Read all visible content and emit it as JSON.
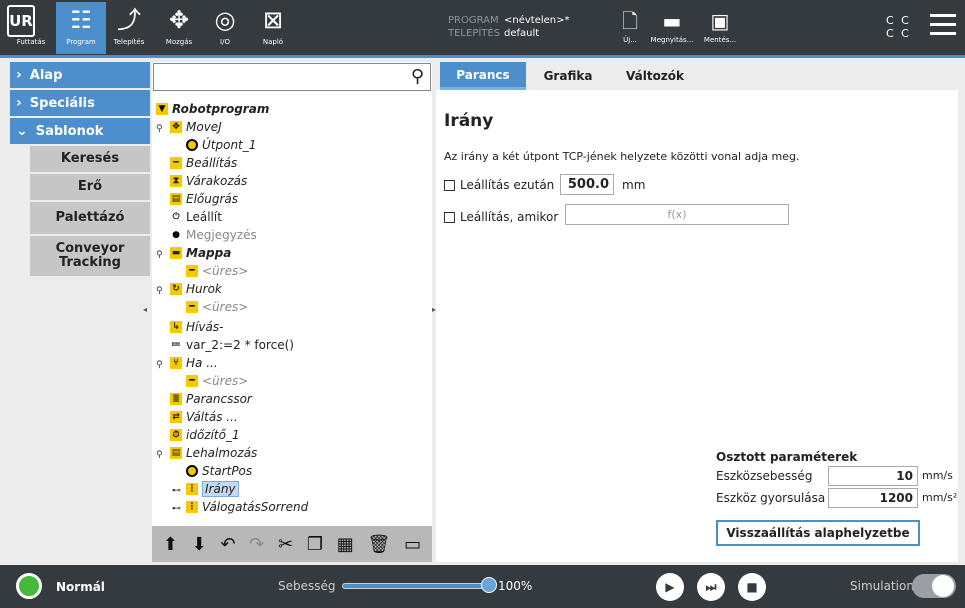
{
  "top_nav": [
    {
      "label": "Futtatás",
      "icon": "run-icon",
      "active": false
    },
    {
      "label": "Program",
      "icon": "program-icon",
      "active": true
    },
    {
      "label": "Telepítés",
      "icon": "installation-icon",
      "active": false
    },
    {
      "label": "Mozgás",
      "icon": "move-icon",
      "active": false
    },
    {
      "label": "I/O",
      "icon": "io-icon",
      "active": false
    },
    {
      "label": "Napló",
      "icon": "log-icon",
      "active": false
    }
  ],
  "program_info": {
    "program_key": "PROGRAM",
    "program_value": "<névtelen>*",
    "install_key": "TELEPÍTÉS",
    "install_value": "default"
  },
  "file_buttons": [
    {
      "label": "Új...",
      "icon": "new-file-icon"
    },
    {
      "label": "Megnyitás...",
      "icon": "folder-icon"
    },
    {
      "label": "Mentés...",
      "icon": "save-icon"
    }
  ],
  "cc_text": {
    "line1": "C C",
    "line2": "C C"
  },
  "sidebar": {
    "categories": [
      {
        "label": "Alap",
        "expanded": false
      },
      {
        "label": "Speciális",
        "expanded": false
      },
      {
        "label": "Sablonok",
        "expanded": true
      }
    ],
    "items": [
      "Keresés",
      "Erő",
      "Palettázó",
      "Conveyor Tracking"
    ]
  },
  "tree": {
    "nodes": [
      {
        "label": "Robotprogram",
        "icon": "flag-icon"
      },
      {
        "label": "MoveJ",
        "icon": "movej-icon"
      },
      {
        "label": "Útpont_1",
        "icon": "waypoint-icon"
      },
      {
        "label": "Beállítás",
        "icon": "set-icon"
      },
      {
        "label": "Várakozás",
        "icon": "wait-icon"
      },
      {
        "label": "Előugrás",
        "icon": "popup-icon"
      },
      {
        "label": "Leállít",
        "icon": "halt-icon"
      },
      {
        "label": "Megjegyzés",
        "icon": "comment-icon"
      },
      {
        "label": "Mappa",
        "icon": "folder-icon"
      },
      {
        "label": "<üres>",
        "icon": "empty-icon"
      },
      {
        "label": "Hurok",
        "icon": "loop-icon"
      },
      {
        "label": "<üres>",
        "icon": "empty-icon"
      },
      {
        "label": "Hívás-",
        "icon": "call-icon"
      },
      {
        "label": "var_2:=2 * force()",
        "icon": "assignment-icon"
      },
      {
        "label": "Ha ...",
        "icon": "if-icon"
      },
      {
        "label": "<üres>",
        "icon": "empty-icon"
      },
      {
        "label": "Parancssor",
        "icon": "script-icon"
      },
      {
        "label": "Váltás ...",
        "icon": "switch-icon"
      },
      {
        "label": "időzítő_1",
        "icon": "timer-icon"
      },
      {
        "label": "Lehalmozás",
        "icon": "stack-icon"
      },
      {
        "label": "StartPos",
        "icon": "waypoint-icon"
      },
      {
        "label": "Irány",
        "icon": "direction-icon"
      },
      {
        "label": "VálogatásSorrend",
        "icon": "sequence-icon"
      }
    ],
    "toolbar": [
      "move-up-icon",
      "move-down-icon",
      "undo-icon",
      "redo-icon",
      "cut-icon",
      "copy-icon",
      "paste-icon",
      "delete-icon",
      "suppress-icon"
    ]
  },
  "tabs": [
    "Parancs",
    "Grafika",
    "Változók"
  ],
  "command": {
    "title": "Irány",
    "description": "Az irány a két útpont TCP-jének helyzete közötti vonal adja meg.",
    "stop_after_label": "Leállítás ezután",
    "stop_after_value": "500.0",
    "stop_after_unit": "mm",
    "stop_when_label": "Leállítás, amikor",
    "stop_when_placeholder": "f(x)"
  },
  "shared_params": {
    "title": "Osztott paraméterek",
    "tool_speed_label": "Eszközsebesség",
    "tool_speed_value": "10",
    "tool_speed_unit": "mm/s",
    "tool_accel_label": "Eszköz gyorsulása",
    "tool_accel_value": "1200",
    "tool_accel_unit": "mm/s²",
    "reset_label": "Visszaállítás alaphelyzetbe"
  },
  "footer": {
    "status": "Normál",
    "status_color": "#47b93a",
    "speed_label": "Sebesség",
    "speed_value": "100%",
    "speed_fraction": 1.0,
    "sim_label": "Simulation"
  },
  "colors": {
    "accent": "#4c8fcc",
    "topbar": "#353a3f"
  }
}
